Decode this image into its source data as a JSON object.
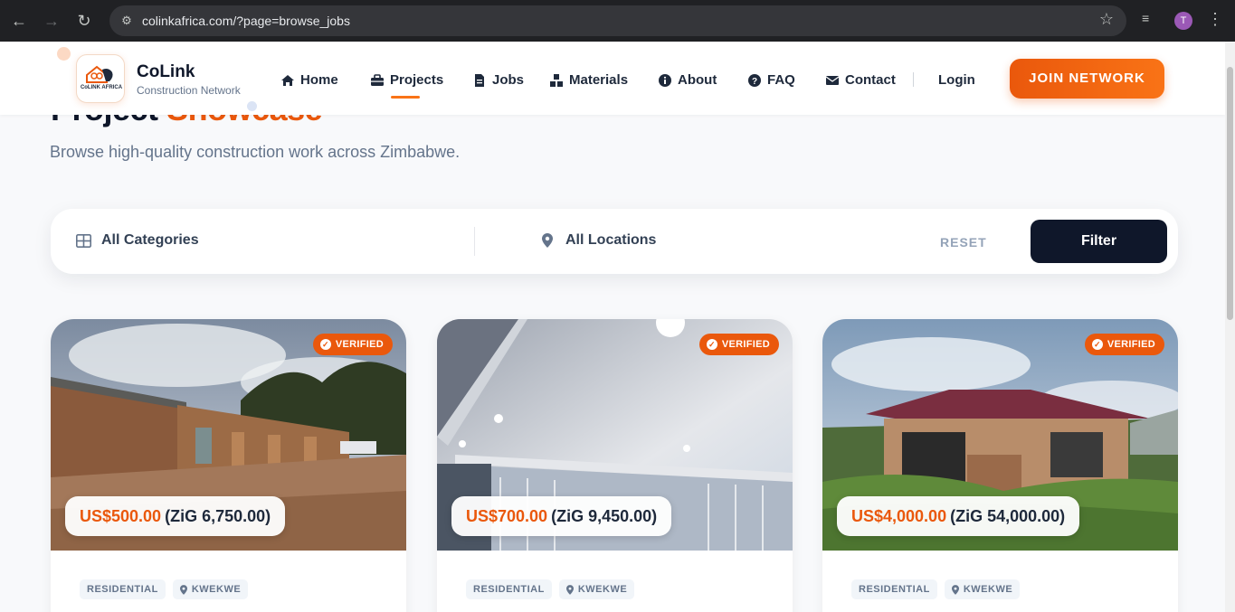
{
  "browser": {
    "url": "colinkafrica.com/?page=browse_jobs",
    "profile_initial": "T"
  },
  "brand": {
    "name": "CoLink",
    "subtitle": "Construction Network",
    "logo_text": "CoLINK AFRICA"
  },
  "nav": {
    "items": [
      {
        "label": "Home",
        "icon": "home-icon"
      },
      {
        "label": "Projects",
        "icon": "briefcase-icon"
      },
      {
        "label": "Jobs",
        "icon": "file-icon"
      },
      {
        "label": "Materials",
        "icon": "boxes-icon"
      },
      {
        "label": "About",
        "icon": "info-icon"
      },
      {
        "label": "FAQ",
        "icon": "question-icon"
      },
      {
        "label": "Contact",
        "icon": "envelope-icon"
      }
    ],
    "active": "Projects",
    "login": "Login",
    "join": "JOIN NETWORK"
  },
  "hero": {
    "title_part1": "Project",
    "title_part2": "Showcase",
    "subtitle": "Browse high-quality construction work across Zimbabwe."
  },
  "filters": {
    "category": "All Categories",
    "location": "All Locations",
    "reset": "RESET",
    "submit": "Filter"
  },
  "cards": [
    {
      "badge": "VERIFIED",
      "price_usd": "US$500.00",
      "price_zig": "(ZiG 6,750.00)",
      "category": "RESIDENTIAL",
      "location": "KWEKWE"
    },
    {
      "badge": "VERIFIED",
      "price_usd": "US$700.00",
      "price_zig": "(ZiG 9,450.00)",
      "category": "RESIDENTIAL",
      "location": "KWEKWE"
    },
    {
      "badge": "VERIFIED",
      "price_usd": "US$4,000.00",
      "price_zig": "(ZiG 54,000.00)",
      "category": "RESIDENTIAL",
      "location": "KWEKWE"
    }
  ],
  "colors": {
    "accent": "#ea580c",
    "dark": "#0f172a",
    "muted": "#64748b"
  }
}
